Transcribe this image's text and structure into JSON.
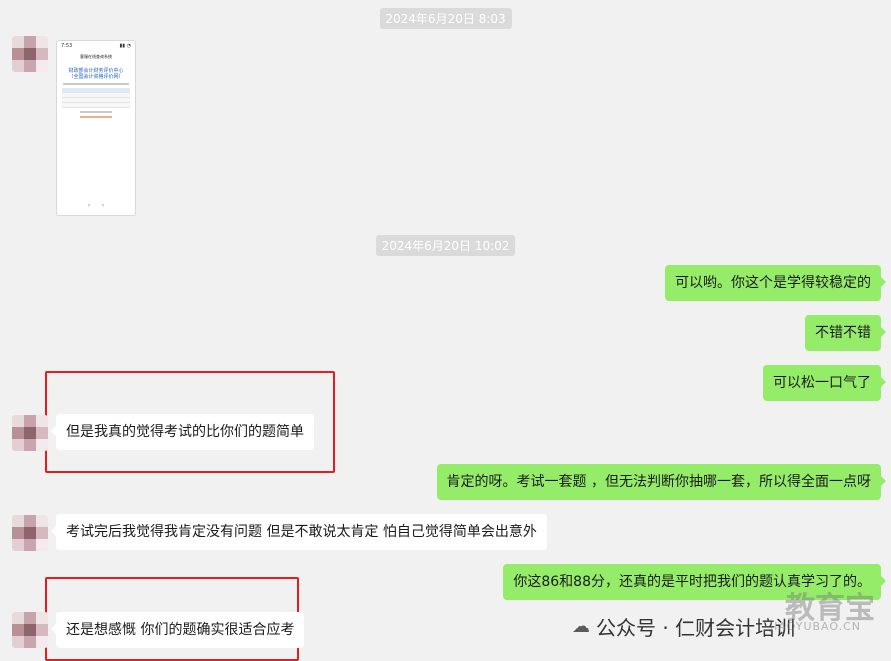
{
  "timestamps": [
    "2024年6月20日 8:03",
    "2024年6月20日 10:02"
  ],
  "messages": [
    {
      "side": "out",
      "text": "可以哟。你这个是学得较稳定的"
    },
    {
      "side": "out",
      "text": "不错不错"
    },
    {
      "side": "out",
      "text": "可以松一口气了"
    },
    {
      "side": "in",
      "text": "但是我真的觉得考试的比你们的题简单"
    },
    {
      "side": "out",
      "text": "肯定的呀。考试一套题 ，但无法判断你抽哪一套，所以得全面一点呀"
    },
    {
      "side": "in",
      "text": "考试完后我觉得我肯定没有问题  但是不敢说太肯定 怕自己觉得简单会出意外"
    },
    {
      "side": "out",
      "text": "你这86和88分，还真的是平时把我们的题认真学习了的。"
    },
    {
      "side": "in",
      "text": "还是想感慨  你们的题确实很适合应考"
    }
  ],
  "image_message": {
    "time": "7:53",
    "nav_title": "客服在线查询系统",
    "title_line1": "财政部会计财务评价中心",
    "title_line2": "（全国会计资格评价网）"
  },
  "watermark": {
    "account": "公众号 · 仁财会计培训",
    "brand": "教育宝",
    "brand_url": "JIAOYUBAO.CN"
  }
}
